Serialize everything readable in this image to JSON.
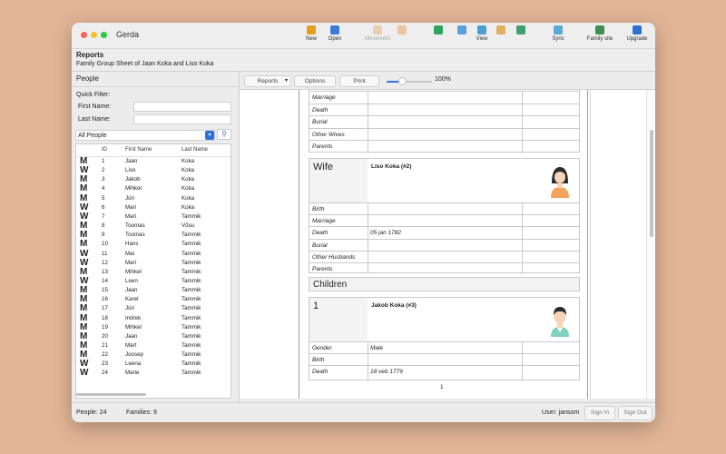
{
  "app": {
    "title": "Gerda"
  },
  "toolbar": [
    {
      "label": "New",
      "icon": "new-person-icon",
      "color": "#e6a020",
      "disabled": false
    },
    {
      "label": "Open",
      "icon": "open-icon",
      "color": "#3d7bd8",
      "disabled": false
    },
    {
      "label": "Movement",
      "icon": "movement-arrows-icon",
      "color": "#e8b47c",
      "disabled": true
    },
    {
      "label": "",
      "icon": "home-icon",
      "color": "#e8a060",
      "disabled": true
    },
    {
      "label": "",
      "icon": "tree-view-icon",
      "color": "#2fa360",
      "disabled": false
    },
    {
      "label": "",
      "icon": "photo-view-icon",
      "color": "#5aa0d8",
      "disabled": false
    },
    {
      "label": "View",
      "icon": "fan-chart-icon",
      "color": "#4b9fd6",
      "disabled": false
    },
    {
      "label": "",
      "icon": "report-view-icon",
      "color": "#e0b060",
      "disabled": false
    },
    {
      "label": "",
      "icon": "map-view-icon",
      "color": "#3f9f6f",
      "disabled": false
    },
    {
      "label": "Sync",
      "icon": "cloud-sync-icon",
      "color": "#5aaad8",
      "disabled": false
    },
    {
      "label": "Family site",
      "icon": "globe-icon",
      "color": "#3f8f4f",
      "disabled": false
    },
    {
      "label": "Upgrade",
      "icon": "upgrade-icon",
      "color": "#2f6fd0",
      "disabled": false
    }
  ],
  "reports_header": {
    "title": "Reports",
    "subtitle": "Family Group Sheet of Jaan Koka and Liso Koka"
  },
  "sidebar": {
    "title": "People",
    "quick_filter": "Quick Filter:",
    "first_name_label": "First Name:",
    "last_name_label": "Last Name:",
    "first_name_value": "",
    "last_name_value": "",
    "select_value": "All People",
    "columns": {
      "id": "ID",
      "first": "First Name",
      "last": "Last Name"
    },
    "people": [
      {
        "g": "M",
        "id": "1",
        "first": "Jaan",
        "last": "Koka"
      },
      {
        "g": "W",
        "id": "2",
        "first": "Liso",
        "last": "Koka"
      },
      {
        "g": "M",
        "id": "3",
        "first": "Jakob",
        "last": "Koka"
      },
      {
        "g": "M",
        "id": "4",
        "first": "Mihkel",
        "last": "Koka"
      },
      {
        "g": "M",
        "id": "5",
        "first": "Jüri",
        "last": "Koka"
      },
      {
        "g": "W",
        "id": "6",
        "first": "Mari",
        "last": "Koka"
      },
      {
        "g": "W",
        "id": "7",
        "first": "Mari",
        "last": "Tammik"
      },
      {
        "g": "M",
        "id": "8",
        "first": "Toomas",
        "last": "Võsu"
      },
      {
        "g": "M",
        "id": "9",
        "first": "Toomas",
        "last": "Tammik"
      },
      {
        "g": "M",
        "id": "10",
        "first": "Hans",
        "last": "Tammik"
      },
      {
        "g": "W",
        "id": "11",
        "first": "Mai",
        "last": "Tammik"
      },
      {
        "g": "W",
        "id": "12",
        "first": "Mari",
        "last": "Tammik"
      },
      {
        "g": "M",
        "id": "13",
        "first": "Mihkel",
        "last": "Tammik"
      },
      {
        "g": "W",
        "id": "14",
        "first": "Leen",
        "last": "Tammik"
      },
      {
        "g": "M",
        "id": "15",
        "first": "Jaan",
        "last": "Tammik"
      },
      {
        "g": "M",
        "id": "16",
        "first": "Karel",
        "last": "Tammik"
      },
      {
        "g": "M",
        "id": "17",
        "first": "Jüri",
        "last": "Tammik"
      },
      {
        "g": "M",
        "id": "18",
        "first": "Indrek",
        "last": "Tammik"
      },
      {
        "g": "M",
        "id": "19",
        "first": "Mihkel",
        "last": "Tammik"
      },
      {
        "g": "M",
        "id": "20",
        "first": "Jaan",
        "last": "Tammik"
      },
      {
        "g": "M",
        "id": "21",
        "first": "Mart",
        "last": "Tammik"
      },
      {
        "g": "M",
        "id": "22",
        "first": "Joosep",
        "last": "Tammik"
      },
      {
        "g": "W",
        "id": "23",
        "first": "Leena",
        "last": "Tammik"
      },
      {
        "g": "W",
        "id": "24",
        "first": "Marie",
        "last": "Tammik"
      }
    ]
  },
  "report_toolbar": {
    "reports": "Reports",
    "options": "Options",
    "print": "Print",
    "zoom": "100%",
    "zoom_level": 0.35
  },
  "report": {
    "husband_rows": [
      {
        "label": "Marriage",
        "value": ""
      },
      {
        "label": "Death",
        "value": ""
      },
      {
        "label": "Burial",
        "value": ""
      },
      {
        "label": "Other Wives",
        "value": ""
      },
      {
        "label": "Parents",
        "value": ""
      }
    ],
    "wife": {
      "title": "Wife",
      "name": "Liso Koka (#2)",
      "rows": [
        {
          "label": "Birth",
          "value": ""
        },
        {
          "label": "Marriage",
          "value": ""
        },
        {
          "label": "Death",
          "value": "05 jan 1782"
        },
        {
          "label": "Burial",
          "value": ""
        },
        {
          "label": "Other Husbands",
          "value": ""
        },
        {
          "label": "Parents",
          "value": ""
        }
      ]
    },
    "children_title": "Children",
    "child": {
      "title": "1",
      "name": "Jakob Koka (#3)",
      "rows": [
        {
          "label": "Gender",
          "value": "Male"
        },
        {
          "label": "Birth",
          "value": ""
        },
        {
          "label": "Death",
          "value": "18 veb 1779"
        }
      ]
    },
    "page_number": "1"
  },
  "status": {
    "people": "People: 24",
    "families": "Families: 9",
    "user": "User: jansom",
    "sign_in": "Sign In",
    "sign_out": "Sign Out"
  }
}
